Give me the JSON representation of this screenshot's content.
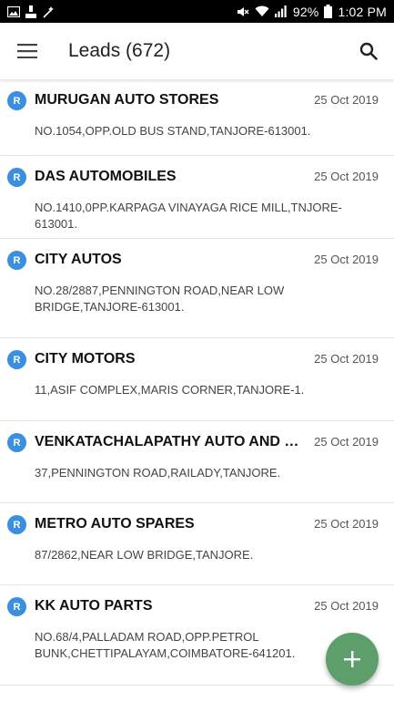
{
  "statusbar": {
    "battery": "92%",
    "time": "1:02 PM"
  },
  "appbar": {
    "title": "Leads (672)"
  },
  "leads": [
    {
      "badge": "R",
      "name": "MURUGAN AUTO STORES",
      "date": "25 Oct 2019",
      "address": "NO.1054,OPP.OLD BUS STAND,TANJORE-613001."
    },
    {
      "badge": "R",
      "name": "DAS AUTOMOBILES",
      "date": "25 Oct 2019",
      "address": "NO.1410,0PP.KARPAGA VINAYAGA RICE MILL,TNJORE-613001."
    },
    {
      "badge": "R",
      "name": "CITY AUTOS",
      "date": "25 Oct 2019",
      "address": "NO.28/2887,PENNINGTON ROAD,NEAR LOW BRIDGE,TANJORE-613001."
    },
    {
      "badge": "R",
      "name": "CITY MOTORS",
      "date": "25 Oct 2019",
      "address": "11,ASIF COMPLEX,MARIS CORNER,TANJORE-1."
    },
    {
      "badge": "R",
      "name": "VENKATACHALAPATHY AUTO AND OIL...",
      "date": "25 Oct 2019",
      "address": "37,PENNINGTON ROAD,RAILADY,TANJORE."
    },
    {
      "badge": "R",
      "name": "METRO AUTO SPARES",
      "date": "25 Oct 2019",
      "address": "87/2862,NEAR LOW BRIDGE,TANJORE."
    },
    {
      "badge": "R",
      "name": "KK AUTO PARTS",
      "date": "25 Oct 2019",
      "address": "NO.68/4,PALLADAM ROAD,OPP.PETROL BUNK,CHETTIPALAYAM,COIMBATORE-641201."
    }
  ],
  "colors": {
    "badge": "#3a8fe0",
    "fab": "#5e9e6a",
    "statusbar": "#000000"
  },
  "icons": {
    "menu": "hamburger-menu-icon",
    "search": "search-icon",
    "fab": "plus-icon"
  }
}
